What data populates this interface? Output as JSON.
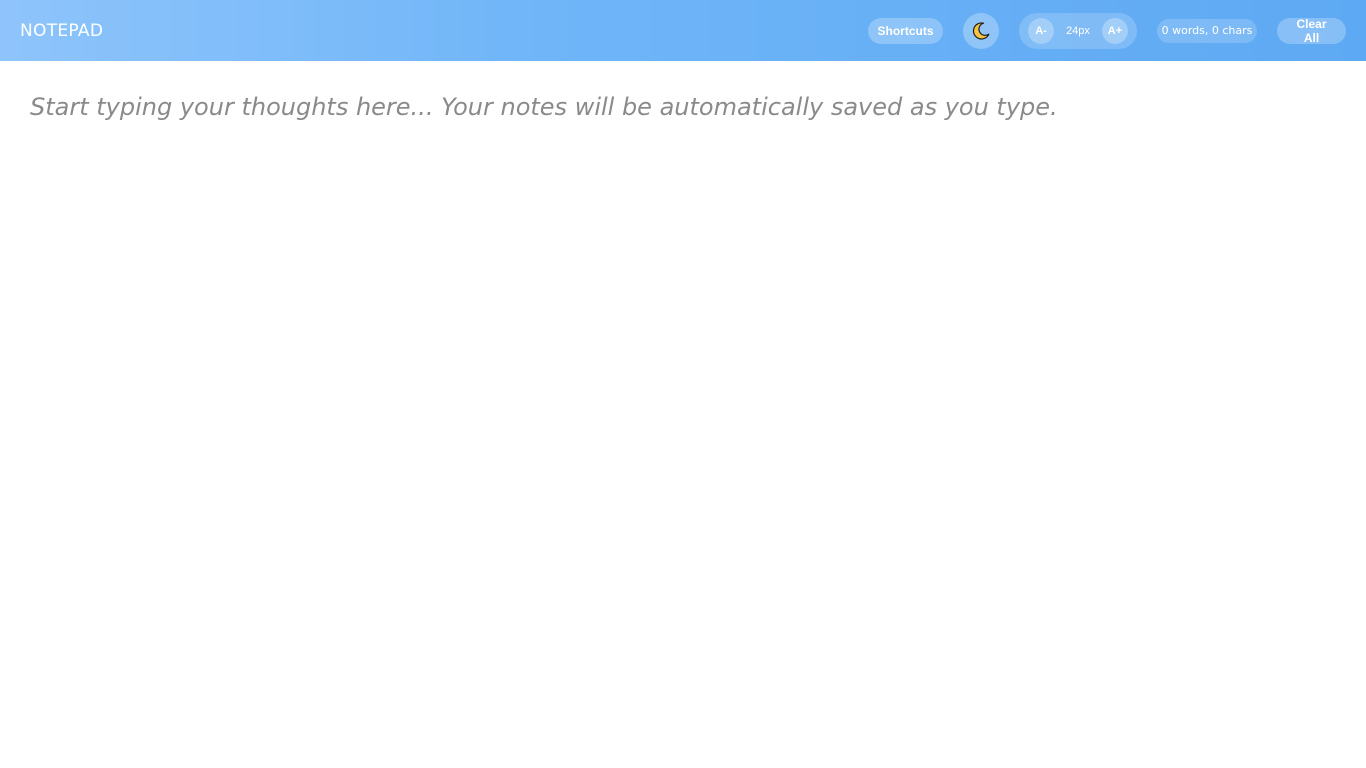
{
  "header": {
    "title": "NOTEPAD",
    "shortcuts_label": "Shortcuts",
    "theme_icon": "moon-icon",
    "font_decrease_label": "A-",
    "font_size_value": "24px",
    "font_increase_label": "A+",
    "stats_text": "0 words, 0 chars",
    "clear_label": "Clear All"
  },
  "editor": {
    "value": "",
    "placeholder": "Start typing your thoughts here... Your notes will be automatically saved as you type."
  },
  "colors": {
    "header_gradient_start": "#8ec4fb",
    "header_gradient_end": "#5ea9f3",
    "moon": "#f5c542",
    "placeholder_text": "#8a8a8a"
  }
}
